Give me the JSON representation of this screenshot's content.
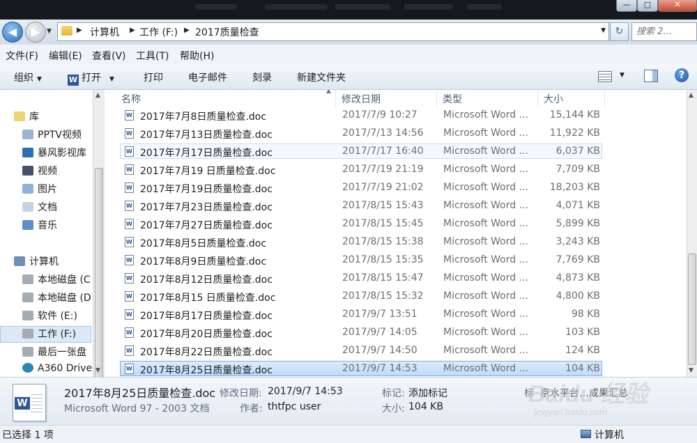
{
  "address_bar": {
    "breadcrumbs": [
      "计算机",
      "工作 (F:)",
      "2017质量检查"
    ],
    "search_placeholder": "搜索 2..."
  },
  "menu": [
    "文件(F)",
    "编辑(E)",
    "查看(V)",
    "工具(T)",
    "帮助(H)"
  ],
  "toolbar": {
    "organize": "组织",
    "open": "打开",
    "print": "打印",
    "email": "电子邮件",
    "burn": "刻录",
    "new_folder": "新建文件夹"
  },
  "nav": {
    "library": "库",
    "library_items": [
      "PPTV视频",
      "暴风影视库",
      "视频",
      "图片",
      "文档",
      "音乐"
    ],
    "computer": "计算机",
    "drives": [
      "本地磁盘 (C",
      "本地磁盘 (D",
      "软件 (E:)",
      "工作 (F:)",
      "最后一张盘",
      "A360 Drive"
    ]
  },
  "columns": {
    "name": "名称",
    "date": "修改日期",
    "type": "类型",
    "size": "大小"
  },
  "files": [
    {
      "name": "2017年7月8日质量检查.doc",
      "date": "2017/7/9 10:27",
      "type": "Microsoft Word ...",
      "size": "15,144 KB"
    },
    {
      "name": "2017年7月13日质量检查.doc",
      "date": "2017/7/13 14:56",
      "type": "Microsoft Word ...",
      "size": "11,922 KB"
    },
    {
      "name": "2017年7月17日质量检查.doc",
      "date": "2017/7/17 16:40",
      "type": "Microsoft Word ...",
      "size": "6,037 KB"
    },
    {
      "name": "2017年7月19 日质量检查.doc",
      "date": "2017/7/19 21:19",
      "type": "Microsoft Word ...",
      "size": "7,709 KB"
    },
    {
      "name": "2017年7月19日质量检查.doc",
      "date": "2017/7/19 21:02",
      "type": "Microsoft Word ...",
      "size": "18,203 KB"
    },
    {
      "name": "2017年7月23日质量检查.doc",
      "date": "2017/8/15 15:43",
      "type": "Microsoft Word ...",
      "size": "4,071 KB"
    },
    {
      "name": "2017年7月27日质量检查.doc",
      "date": "2017/8/15 15:45",
      "type": "Microsoft Word ...",
      "size": "5,899 KB"
    },
    {
      "name": "2017年8月5日质量检查.doc",
      "date": "2017/8/15 15:38",
      "type": "Microsoft Word ...",
      "size": "3,243 KB"
    },
    {
      "name": "2017年8月9日质量检查.doc",
      "date": "2017/8/15 15:35",
      "type": "Microsoft Word ...",
      "size": "7,769 KB"
    },
    {
      "name": "2017年8月12日质量检查.doc",
      "date": "2017/8/15 15:47",
      "type": "Microsoft Word ...",
      "size": "4,873 KB"
    },
    {
      "name": "2017年8月15 日质量检查.doc",
      "date": "2017/8/15 15:32",
      "type": "Microsoft Word ...",
      "size": "4,800 KB"
    },
    {
      "name": "2017年8月17日质量检查.doc",
      "date": "2017/9/7 13:51",
      "type": "Microsoft Word ...",
      "size": "98 KB"
    },
    {
      "name": "2017年8月20日质量检查.doc",
      "date": "2017/9/7 14:05",
      "type": "Microsoft Word ...",
      "size": "103 KB"
    },
    {
      "name": "2017年8月22日质量检查.doc",
      "date": "2017/9/7 14:50",
      "type": "Microsoft Word ...",
      "size": "124 KB"
    },
    {
      "name": "2017年8月25日质量检查.doc",
      "date": "2017/9/7 14:53",
      "type": "Microsoft Word ...",
      "size": "104 KB"
    }
  ],
  "details": {
    "filename": "2017年8月25日质量检查.doc",
    "filetype": "Microsoft Word 97 - 2003 文档",
    "modified_label": "修改日期:",
    "modified_value": "2017/9/7 14:53",
    "author_label": "作者:",
    "author_value": "thtfpc user",
    "tags_label": "标记:",
    "tags_value": "添加标记",
    "size_label": "大小:",
    "size_value": "104 KB",
    "title_label": "标",
    "title_value": "京水平台…成果汇总"
  },
  "status": {
    "selected": "已选择 1 项",
    "location": "计算机"
  },
  "watermark": {
    "brand": "Baidu 经验",
    "url": "jingyan.baidu.com"
  },
  "window_controls": {
    "minimize": "—",
    "maximize": "□",
    "close": "✕"
  }
}
